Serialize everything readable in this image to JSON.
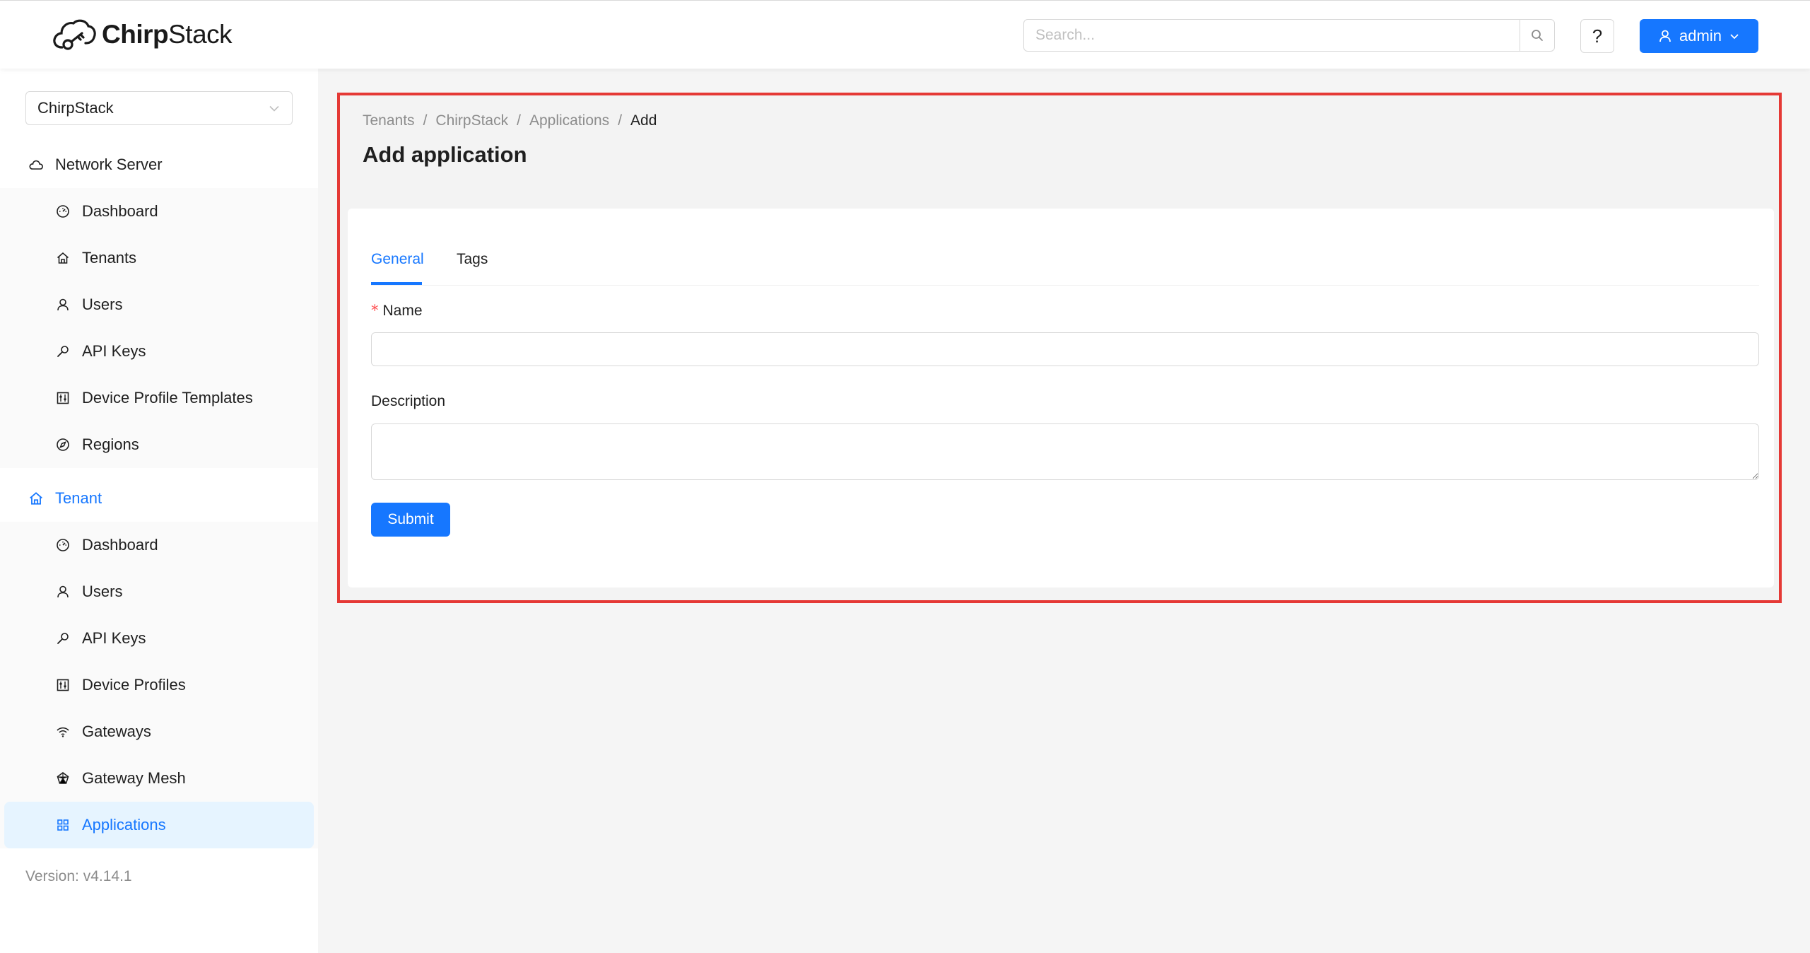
{
  "header": {
    "brand_left": "Chirp",
    "brand_right": "Stack",
    "search_placeholder": "Search...",
    "help_label": "?",
    "user_label": "admin"
  },
  "sidebar": {
    "tenant_selected": "ChirpStack",
    "network_server": {
      "label": "Network Server",
      "items": [
        {
          "label": "Dashboard",
          "icon": "dashboard-icon"
        },
        {
          "label": "Tenants",
          "icon": "home-icon"
        },
        {
          "label": "Users",
          "icon": "user-icon"
        },
        {
          "label": "API Keys",
          "icon": "key-icon"
        },
        {
          "label": "Device Profile Templates",
          "icon": "controls-icon"
        },
        {
          "label": "Regions",
          "icon": "compass-icon"
        }
      ]
    },
    "tenant": {
      "label": "Tenant",
      "items": [
        {
          "label": "Dashboard",
          "icon": "dashboard-icon"
        },
        {
          "label": "Users",
          "icon": "user-icon"
        },
        {
          "label": "API Keys",
          "icon": "key-icon"
        },
        {
          "label": "Device Profiles",
          "icon": "controls-icon"
        },
        {
          "label": "Gateways",
          "icon": "wifi-icon"
        },
        {
          "label": "Gateway Mesh",
          "icon": "mesh-icon"
        },
        {
          "label": "Applications",
          "icon": "apps-icon",
          "selected": true
        }
      ]
    },
    "version": "Version: v4.14.1"
  },
  "main": {
    "breadcrumb": [
      "Tenants",
      "ChirpStack",
      "Applications",
      "Add"
    ],
    "breadcrumb_separator": "/",
    "title": "Add application",
    "tabs": [
      "General",
      "Tags"
    ],
    "active_tab": "General",
    "form": {
      "name_label": "Name",
      "name_required_mark": "*",
      "name_value": "",
      "description_label": "Description",
      "description_value": "",
      "submit_label": "Submit"
    }
  },
  "colors": {
    "primary": "#1677ff",
    "highlight_border": "#e53935",
    "selected_bg": "#e6f4ff"
  }
}
